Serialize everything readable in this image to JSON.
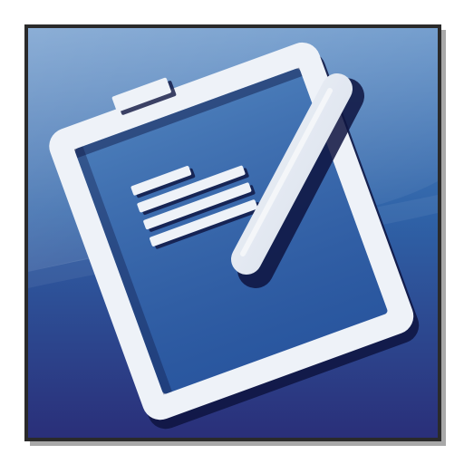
{
  "icon": {
    "name": "clipboard-checklist-icon",
    "subject": "notepad-with-pen",
    "colors": {
      "background_top": "#5f8fc6",
      "background_mid": "#2f63a8",
      "background_bottom": "#2a2f79",
      "highlight": "#8fb5e0",
      "shape_light": "#eef2f8",
      "shape_mid": "#d8dfeb",
      "shape_dark": "#0e1440",
      "frame_border": "#2a2a2a",
      "frame_shadow": "#9a9a9a"
    }
  }
}
